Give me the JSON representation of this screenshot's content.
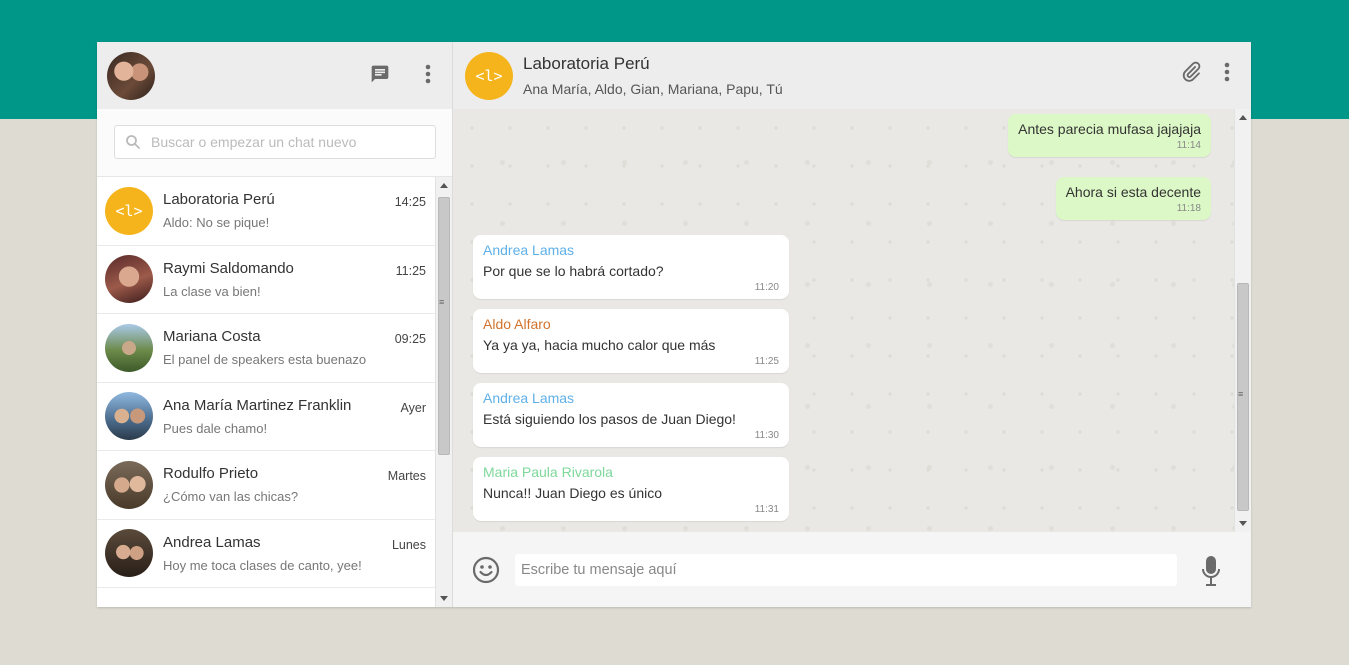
{
  "search": {
    "placeholder": "Buscar o empezar un chat nuevo"
  },
  "chats": [
    {
      "name": "Laboratoria Perú",
      "last": "Aldo: No se pique!",
      "time": "14:25"
    },
    {
      "name": "Raymi Saldomando",
      "last": "La clase va bien!",
      "time": "11:25"
    },
    {
      "name": "Mariana Costa",
      "last": "El panel de speakers esta buenazo",
      "time": "09:25"
    },
    {
      "name": "Ana María Martinez Franklin",
      "last": "Pues dale chamo!",
      "time": "Ayer"
    },
    {
      "name": "Rodulfo Prieto",
      "last": "¿Cómo van las chicas?",
      "time": "Martes"
    },
    {
      "name": "Andrea Lamas",
      "last": "Hoy me toca clases de canto, yee!",
      "time": "Lunes"
    }
  ],
  "conversation": {
    "avatar_text": "<l>",
    "title": "Laboratoria Perú",
    "members": "Ana María, Aldo, Gian, Mariana, Papu, Tú"
  },
  "messages": [
    {
      "dir": "out",
      "text": "Antes parecia mufasa jajajaja",
      "time": "11:14"
    },
    {
      "dir": "out",
      "text": "Ahora si esta decente",
      "time": "11:18"
    },
    {
      "dir": "in",
      "sender": "Andrea Lamas",
      "sender_color": "#5fb0e8",
      "text": "Por que se lo habrá cortado?",
      "time": "11:20"
    },
    {
      "dir": "in",
      "sender": "Aldo Alfaro",
      "sender_color": "#d2732d",
      "text": "Ya ya ya, hacia mucho calor que más",
      "time": "11:25"
    },
    {
      "dir": "in",
      "sender": "Andrea Lamas",
      "sender_color": "#5fb0e8",
      "text": "Está siguiendo los pasos de Juan Diego!",
      "time": "11:30"
    },
    {
      "dir": "in",
      "sender": "Maria Paula Rivarola",
      "sender_color": "#7dd89a",
      "text": "Nunca!! Juan Diego es único",
      "time": "11:31"
    }
  ],
  "composer": {
    "placeholder": "Escribe tu mensaje aquí"
  },
  "colors": {
    "brand": "#009688",
    "outgoing": "#dcf8c6",
    "group_avatar": "#f5b41b"
  }
}
